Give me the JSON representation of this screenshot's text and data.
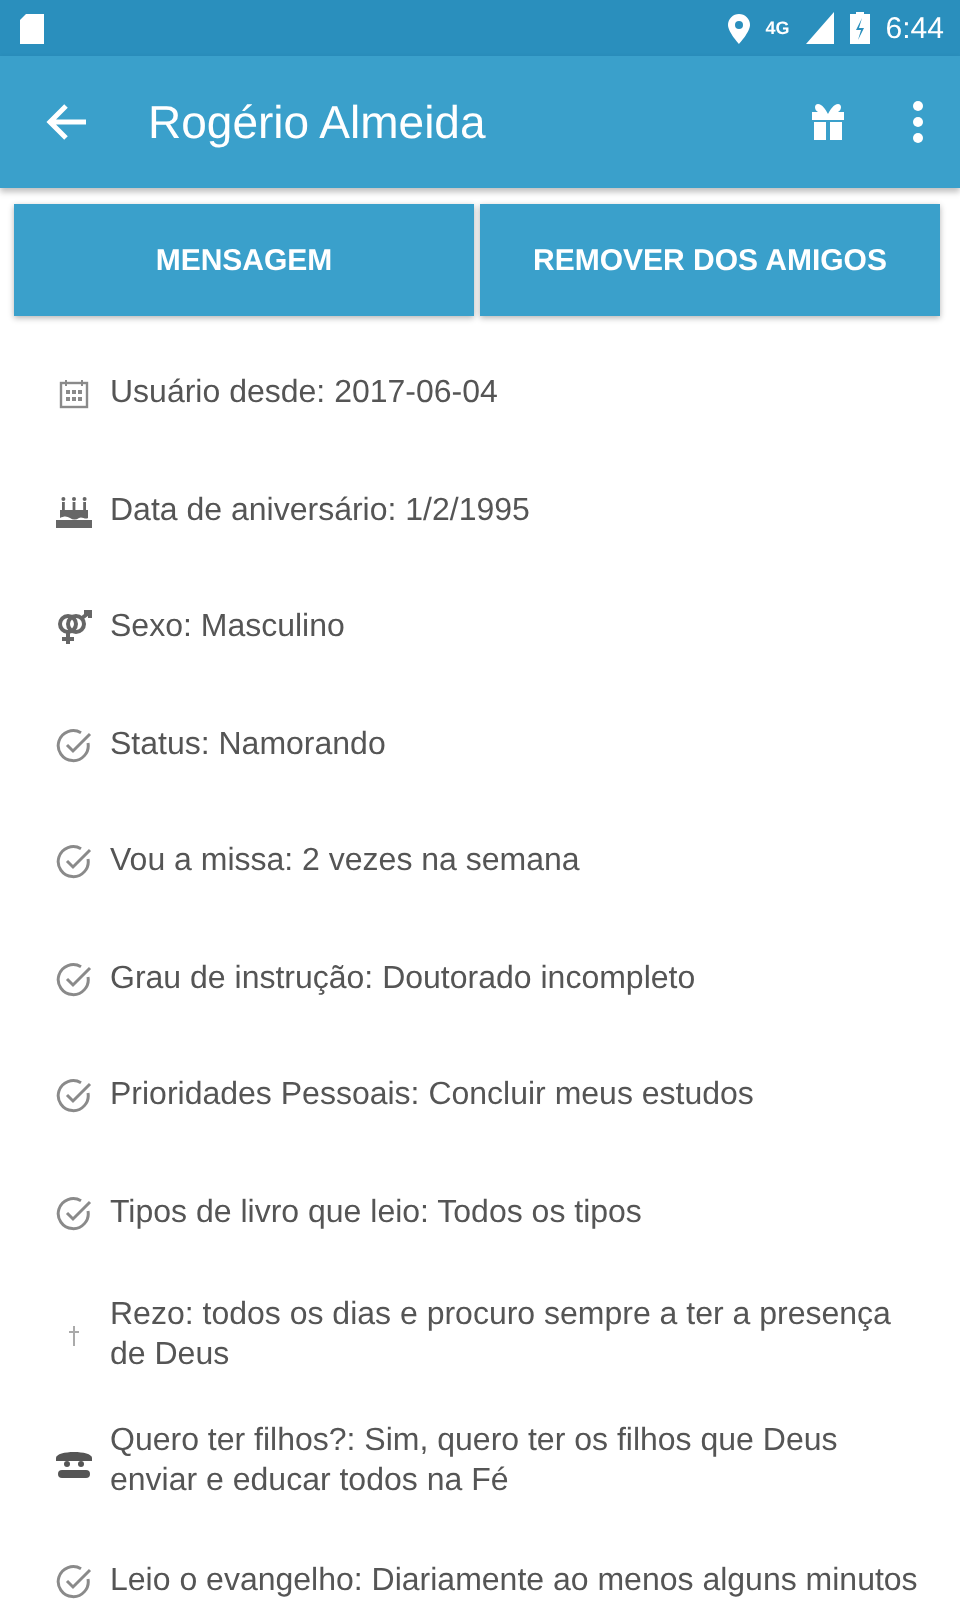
{
  "status_bar": {
    "time": "6:44",
    "network": "4G"
  },
  "app_bar": {
    "title": "Rogério Almeida"
  },
  "buttons": [
    "MENSAGEM",
    "REMOVER DOS AMIGOS"
  ],
  "details": [
    {
      "kind": "calendar",
      "text": "Usuário desde: 2017-06-04"
    },
    {
      "kind": "cake",
      "text": "Data de aniversário: 1/2/1995"
    },
    {
      "kind": "gender",
      "text": "Sexo: Masculino"
    },
    {
      "kind": "check",
      "text": "Status: Namorando"
    },
    {
      "kind": "check",
      "text": "Vou a missa: 2 vezes na semana"
    },
    {
      "kind": "check",
      "text": "Grau de instrução: Doutorado incompleto"
    },
    {
      "kind": "check",
      "text": "Prioridades Pessoais: Concluir meus estudos"
    },
    {
      "kind": "check",
      "text": "Tipos de livro que leio: Todos os tipos"
    },
    {
      "kind": "cross",
      "text": "Rezo: todos os dias e procuro sempre a ter a presença de Deus"
    },
    {
      "kind": "baby",
      "text": "Quero ter filhos?: Sim, quero ter os filhos que Deus enviar e educar todos na Fé"
    },
    {
      "kind": "check",
      "text": "Leio o evangelho: Diariamente ao menos alguns minutos"
    }
  ]
}
